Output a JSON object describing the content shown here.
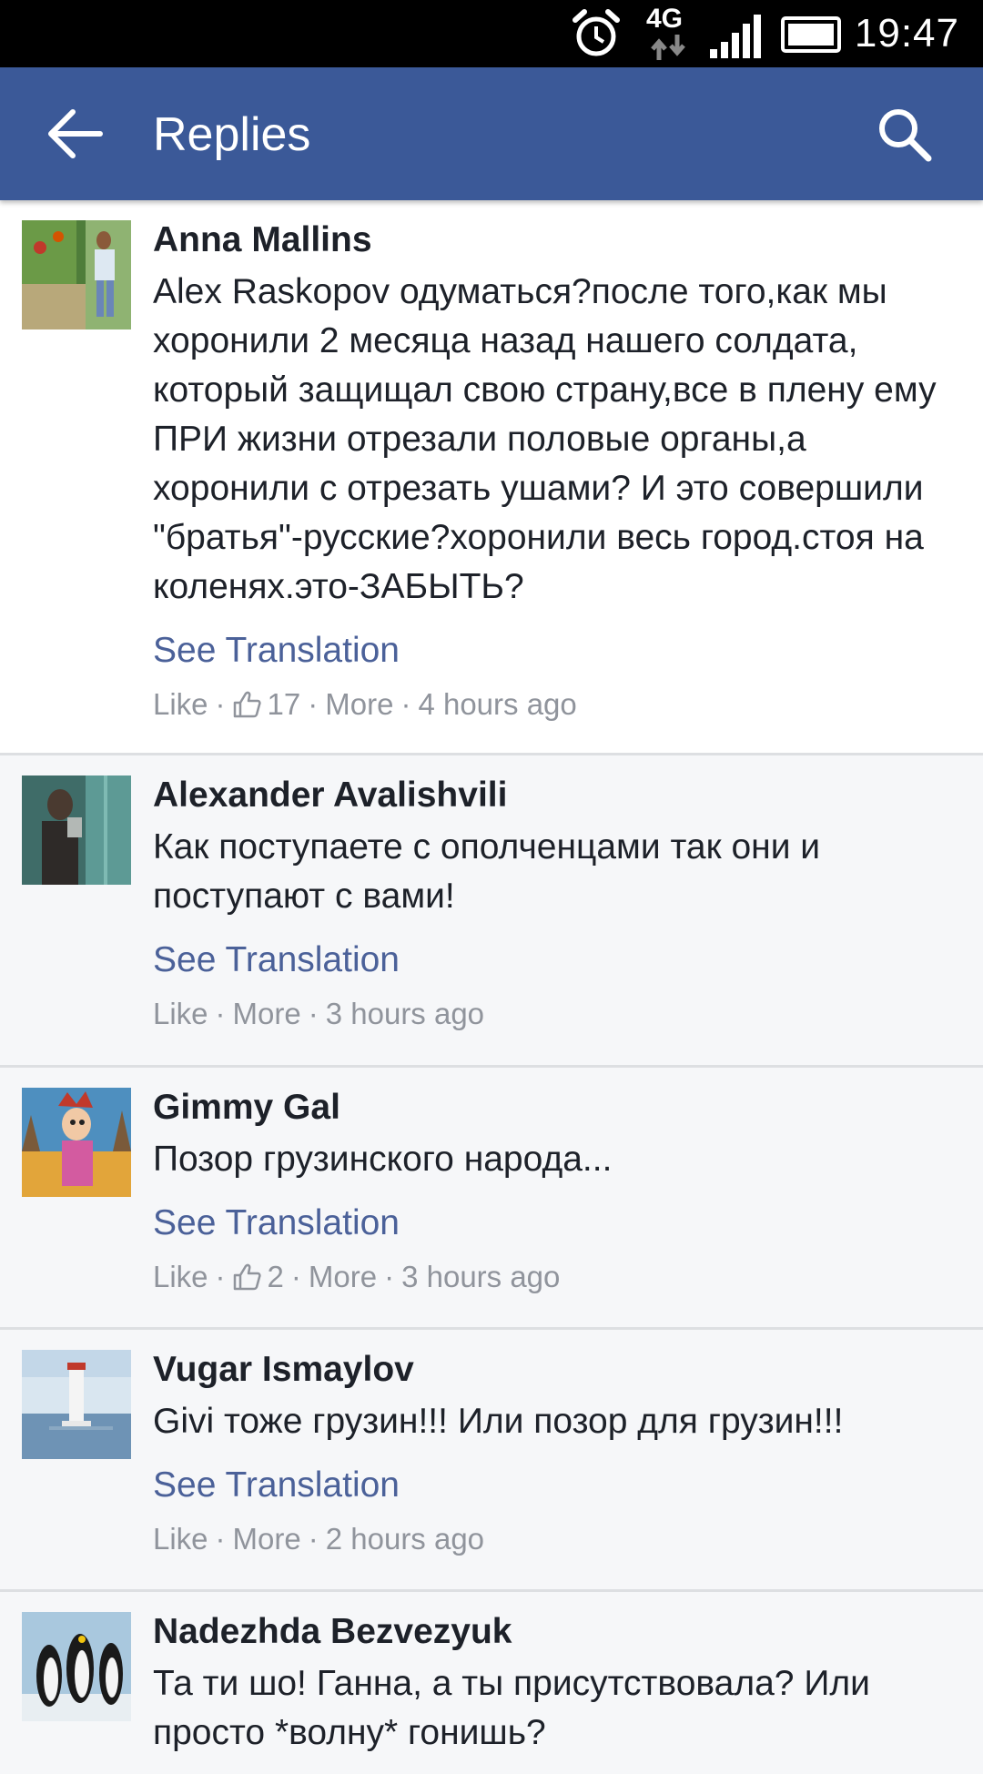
{
  "status_bar": {
    "network_label": "4G",
    "time": "19:47",
    "icons": [
      "alarm-icon",
      "network-4g-icon",
      "signal-icon",
      "battery-icon"
    ]
  },
  "app_bar": {
    "title": "Replies",
    "color": "#3b5998",
    "back_icon": "arrow-left-icon",
    "search_icon": "search-icon"
  },
  "actions": {
    "see_translation": "See Translation",
    "like": "Like",
    "more": "More",
    "separator": "·"
  },
  "comments": [
    {
      "author": "Anna Mallins",
      "text": "Alex Raskopov одуматься?после того,как мы хоронили 2 месяца назад нашего солдата, который защищал свою страну,все в плену ему ПРИ жизни отрезали половые органы,а хоронили с отрезать ушами? И это совершили \"братья\"-русские?хоронили весь город.стоя на коленях.это-ЗАБЫТЬ?",
      "like_count": "17",
      "time": "4 hours ago"
    },
    {
      "author": "Alexander Avalishvili",
      "text": "Как поступаете с ополченцами так они и поступают с вами!",
      "like_count": null,
      "time": "3 hours ago"
    },
    {
      "author": "Gimmy Gal",
      "text": "Позор грузинского народа...",
      "like_count": "2",
      "time": "3 hours ago"
    },
    {
      "author": "Vugar Ismaylov",
      "text": "Givi тоже грузин!!! Или позор для грузин!!!",
      "like_count": null,
      "time": "2 hours ago"
    },
    {
      "author": "Nadezhda Bezvezyuk",
      "text": "Та ти шо! Ганна, а ты присутствовала? Или просто *волну* гонишь?",
      "like_count": null,
      "time": null
    }
  ],
  "colors": {
    "link": "#4b6199",
    "meta": "#90949c",
    "text": "#1d2129",
    "row_background": "#f6f7f9"
  }
}
